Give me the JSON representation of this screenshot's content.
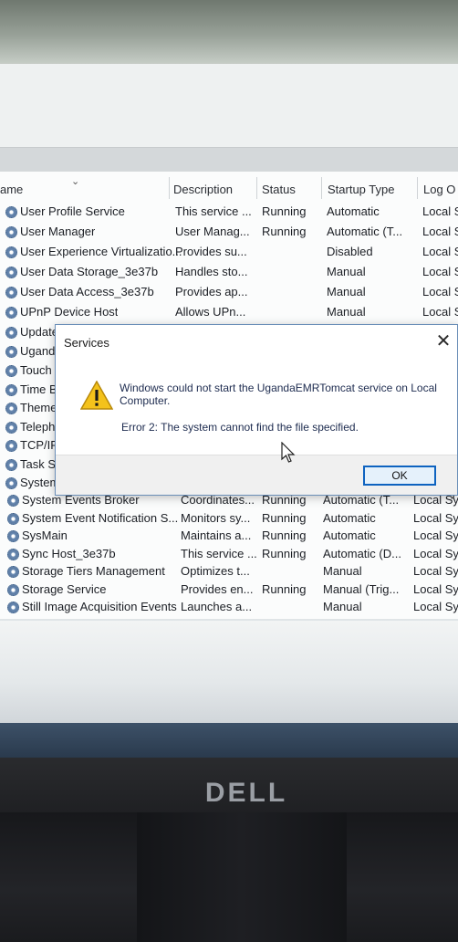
{
  "list": {
    "columns": {
      "name": "ame",
      "description": "Description",
      "status": "Status",
      "startup_type": "Startup Type",
      "log_on": "Log O"
    },
    "rows": [
      {
        "name": "User Profile Service",
        "description": "This service ...",
        "status": "Running",
        "startup": "Automatic",
        "logon": "Local S"
      },
      {
        "name": "User Manager",
        "description": "User Manag...",
        "status": "Running",
        "startup": "Automatic (T...",
        "logon": "Local S"
      },
      {
        "name": "User Experience Virtualizatio...",
        "description": "Provides su...",
        "status": "",
        "startup": "Disabled",
        "logon": "Local S"
      },
      {
        "name": "User Data Storage_3e37b",
        "description": "Handles sto...",
        "status": "",
        "startup": "Manual",
        "logon": "Local S"
      },
      {
        "name": "User Data Access_3e37b",
        "description": "Provides ap...",
        "status": "",
        "startup": "Manual",
        "logon": "Local S"
      },
      {
        "name": "UPnP Device Host",
        "description": "Allows UPn...",
        "status": "",
        "startup": "Manual",
        "logon": "Local S"
      },
      {
        "name": "Update",
        "description": "",
        "status": "",
        "startup": "",
        "logon": ""
      },
      {
        "name": "Uganda",
        "description": "",
        "status": "",
        "startup": "",
        "logon": ""
      },
      {
        "name": "Touch K",
        "description": "",
        "status": "",
        "startup": "",
        "logon": ""
      },
      {
        "name": "Time Br",
        "description": "",
        "status": "",
        "startup": "",
        "logon": ""
      },
      {
        "name": "Themes",
        "description": "",
        "status": "",
        "startup": "",
        "logon": ""
      },
      {
        "name": "Telepho",
        "description": "",
        "status": "",
        "startup": "",
        "logon": ""
      },
      {
        "name": "TCP/IP",
        "description": "",
        "status": "",
        "startup": "",
        "logon": ""
      },
      {
        "name": "Task Sch",
        "description": "",
        "status": "",
        "startup": "",
        "logon": ""
      },
      {
        "name": "System",
        "description": "",
        "status": "",
        "startup": "",
        "logon": ""
      },
      {
        "name": "System Events Broker",
        "description": "Coordinates...",
        "status": "Running",
        "startup": "Automatic (T...",
        "logon": "Local Sy"
      },
      {
        "name": "System Event Notification S...",
        "description": "Monitors sy...",
        "status": "Running",
        "startup": "Automatic",
        "logon": "Local Sys"
      },
      {
        "name": "SysMain",
        "description": "Maintains a...",
        "status": "Running",
        "startup": "Automatic",
        "logon": "Local Sys"
      },
      {
        "name": "Sync Host_3e37b",
        "description": "This service ...",
        "status": "Running",
        "startup": "Automatic (D...",
        "logon": "Local Sys"
      },
      {
        "name": "Storage Tiers Management",
        "description": "Optimizes t...",
        "status": "",
        "startup": "Manual",
        "logon": "Local Sys"
      },
      {
        "name": "Storage Service",
        "description": "Provides en...",
        "status": "Running",
        "startup": "Manual (Trig...",
        "logon": "Local Sys"
      },
      {
        "name": "Still Image Acquisition Events",
        "description": "Launches a...",
        "status": "",
        "startup": "Manual",
        "logon": "Local Sys"
      }
    ],
    "partial_right": [
      "y",
      "y"
    ]
  },
  "dialog": {
    "title": "Services",
    "close_glyph": "✕",
    "message": "Windows could not start the UgandaEMRTomcat service on Local Computer.",
    "error": "Error 2: The system cannot find the file specified.",
    "ok_label": "OK"
  },
  "bezel": {
    "brand": "DELL"
  },
  "icons": {
    "service": "gear-icon",
    "warning": "warning-icon",
    "cursor": "mouse-cursor-icon",
    "sort": "chevron-down-icon"
  },
  "colors": {
    "accent": "#0e63c0",
    "warning": "#f4c21b"
  }
}
